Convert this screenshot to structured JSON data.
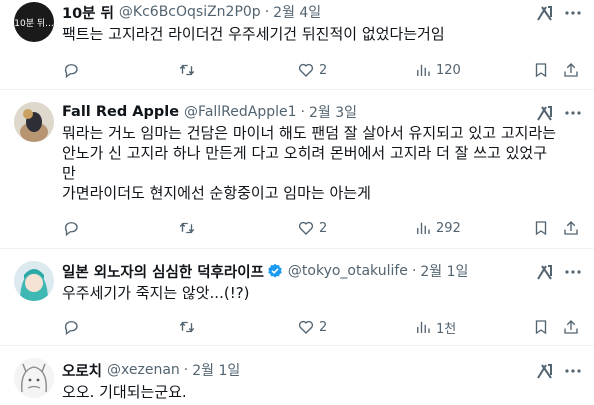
{
  "tweets": [
    {
      "name": "10분 뒤",
      "handle": "@Kc6BcOqsiZn2P0p",
      "dot": "·",
      "date": "2월 4일",
      "avatar_text": "10분 뒤...",
      "lines": [
        "팩트는 고지라건 라이더건 우주세기건 뒤진적이 없었다는거임"
      ],
      "likes": "2",
      "views": "120"
    },
    {
      "name": "Fall Red Apple",
      "handle": "@FallRedApple1",
      "dot": "·",
      "date": "2월 3일",
      "lines": [
        "뭐라는 거노 임마는 건담은 마이너 해도 팬덤 잘 살아서 유지되고 있고 고지라는",
        "안노가 신 고지라 하나 만든게 다고 오히려 몬버에서 고지라 더 잘 쓰고 있었구",
        "만",
        "가면라이더도 현지에선 순항중이고 임마는 아는게"
      ],
      "likes": "2",
      "views": "292"
    },
    {
      "name": "일본 외노자의 심심한 덕후라이프",
      "handle": "@tokyo_otakulife",
      "dot": "·",
      "date": "2월 1일",
      "lines": [
        "우주세기가 죽지는 않앗...(!?)"
      ],
      "likes": "2",
      "views": "1천"
    },
    {
      "name": "오로치",
      "handle": "@xezenan",
      "dot": "·",
      "date": "2월 1일",
      "lines": [
        "오오. 기대되는군요."
      ]
    }
  ],
  "colors": {
    "text": "#0f1419",
    "secondary": "#536471",
    "divider": "#eff3f4",
    "verified": "#1d9bf0"
  },
  "icons": [
    "reply-icon",
    "retweet-icon",
    "like-icon",
    "views-icon",
    "bookmark-icon",
    "share-icon",
    "grok-icon",
    "more-icon",
    "verified-icon"
  ]
}
